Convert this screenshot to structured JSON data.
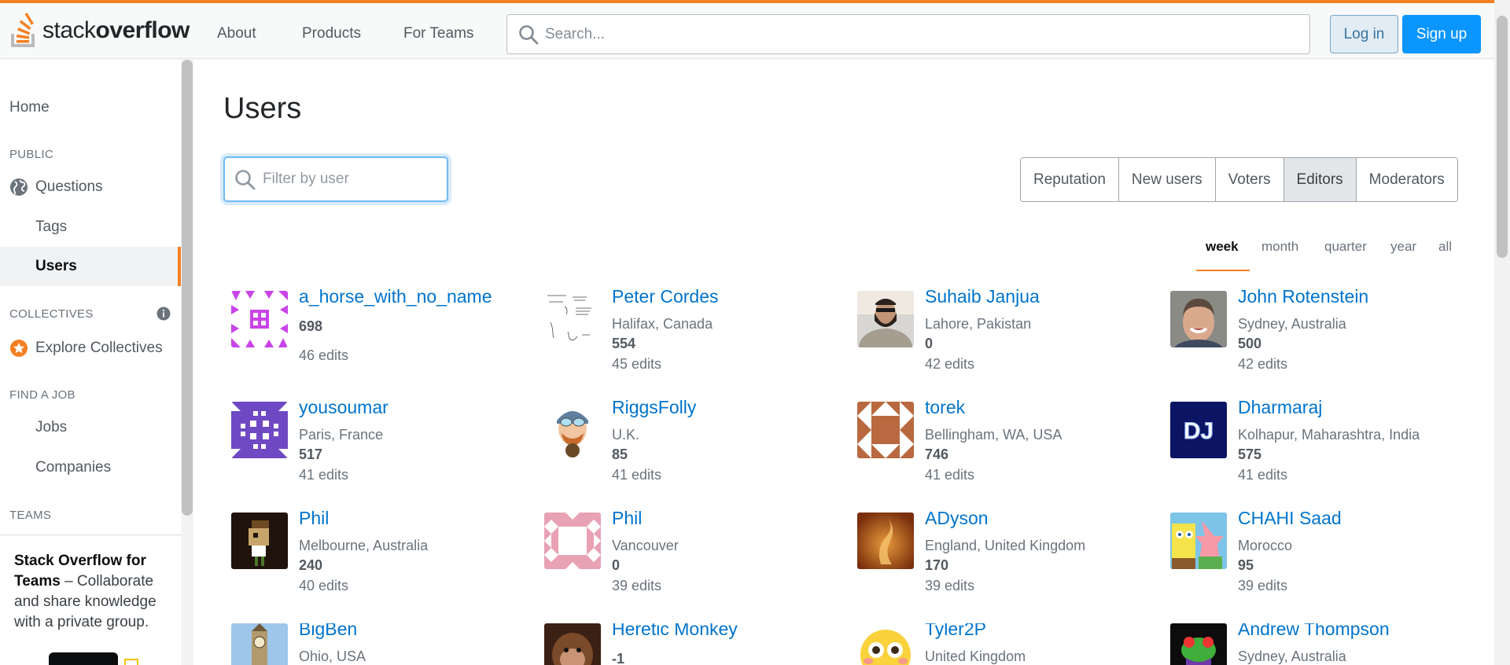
{
  "header": {
    "logo_light": "stack",
    "logo_bold": "overflow",
    "nav": [
      "About",
      "Products",
      "For Teams"
    ],
    "search_placeholder": "Search...",
    "login_label": "Log in",
    "signup_label": "Sign up"
  },
  "sidebar": {
    "home": "Home",
    "public_heading": "PUBLIC",
    "questions": "Questions",
    "tags": "Tags",
    "users": "Users",
    "collectives_heading": "COLLECTIVES",
    "explore_collectives": "Explore Collectives",
    "job_heading": "FIND A JOB",
    "jobs": "Jobs",
    "companies": "Companies",
    "teams_heading": "TEAMS",
    "teams_promo_bold": "Stack Overflow for Teams",
    "teams_promo_text": " – Collaborate and share knowledge with a private group."
  },
  "main": {
    "title": "Users",
    "filter_placeholder": "Filter by user",
    "tabs": [
      "Reputation",
      "New users",
      "Voters",
      "Editors",
      "Moderators"
    ],
    "selected_tab": "Editors",
    "periods": [
      "week",
      "month",
      "quarter",
      "year",
      "all"
    ],
    "selected_period": "week"
  },
  "users": [
    {
      "name": "a_horse_with_no_name",
      "location": "",
      "rep": "698",
      "edits": "46 edits",
      "avatar": "identicon-magenta"
    },
    {
      "name": "Peter Cordes",
      "location": "Halifax, Canada",
      "rep": "554",
      "edits": "45 edits",
      "avatar": "sketch"
    },
    {
      "name": "Suhaib Janjua",
      "location": "Lahore, Pakistan",
      "rep": "0",
      "edits": "42 edits",
      "avatar": "photo-man-sunglasses"
    },
    {
      "name": "John Rotenstein",
      "location": "Sydney, Australia",
      "rep": "500",
      "edits": "42 edits",
      "avatar": "photo-man-smiling"
    },
    {
      "name": "yousoumar",
      "location": "Paris, France",
      "rep": "517",
      "edits": "41 edits",
      "avatar": "identicon-purple"
    },
    {
      "name": "RiggsFolly",
      "location": "U.K.",
      "rep": "85",
      "edits": "41 edits",
      "avatar": "cartoon-aviator"
    },
    {
      "name": "torek",
      "location": "Bellingham, WA, USA",
      "rep": "746",
      "edits": "41 edits",
      "avatar": "identicon-brown"
    },
    {
      "name": "Dharmaraj",
      "location": "Kolhapur, Maharashtra, India",
      "rep": "575",
      "edits": "41 edits",
      "avatar": "dj-logo"
    },
    {
      "name": "Phil",
      "location": "Melbourne, Australia",
      "rep": "240",
      "edits": "40 edits",
      "avatar": "pixel-character"
    },
    {
      "name": "Phil",
      "location": "Vancouver",
      "rep": "0",
      "edits": "39 edits",
      "avatar": "identicon-pink"
    },
    {
      "name": "ADyson",
      "location": "England, United Kingdom",
      "rep": "170",
      "edits": "39 edits",
      "avatar": "orange-art"
    },
    {
      "name": "CHAHI Saad",
      "location": "Morocco",
      "rep": "95",
      "edits": "39 edits",
      "avatar": "cartoon-spongebob"
    },
    {
      "name": "BigBen",
      "location": "Ohio, USA",
      "rep": "",
      "edits": "",
      "avatar": "photo-clocktower"
    },
    {
      "name": "Heretic Monkey",
      "location": "",
      "rep": "-1",
      "edits": "",
      "avatar": "photo-monkey"
    },
    {
      "name": "Tyler2P",
      "location": "United Kingdom",
      "rep": "",
      "edits": "",
      "avatar": "emoji-flushed"
    },
    {
      "name": "Andrew Thompson",
      "location": "Sydney, Australia",
      "rep": "",
      "edits": "",
      "avatar": "frog-art"
    }
  ],
  "colors": {
    "accent": "#f48024",
    "link": "#0074cc",
    "signup": "#0a95ff"
  }
}
